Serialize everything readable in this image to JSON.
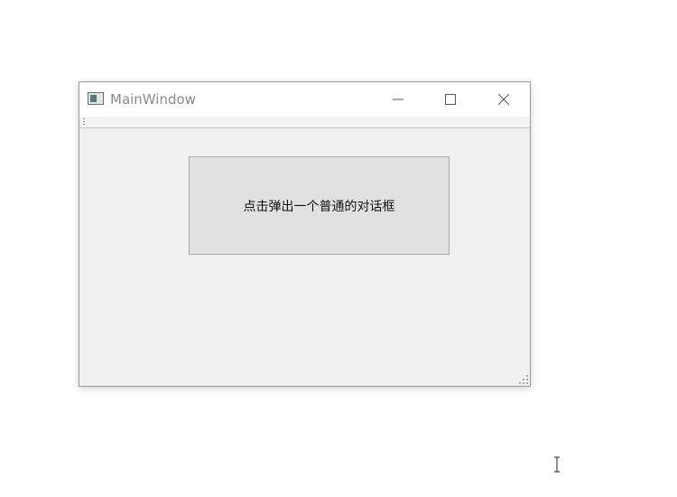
{
  "window": {
    "title": "MainWindow",
    "icon": "app-window-icon",
    "controls": [
      "minimize-icon",
      "maximize-icon",
      "close-icon"
    ]
  },
  "main": {
    "button_label": "点击弹出一个普通的对话框"
  },
  "cursor": "text-ibeam-cursor-icon",
  "colors": {
    "client_bg": "#f0f0f0",
    "titlebar_bg": "#ffffff",
    "button_bg": "#e1e1e1",
    "button_border": "#adadad"
  }
}
